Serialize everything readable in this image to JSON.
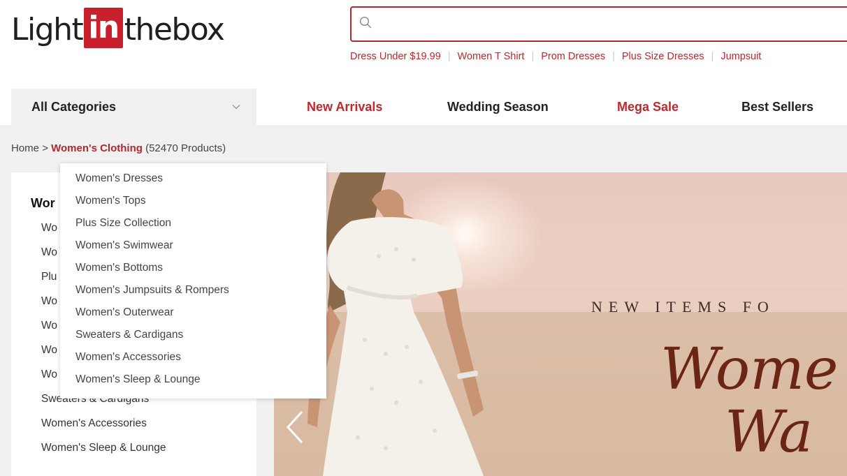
{
  "header": {
    "logo": {
      "left": "Light",
      "box": "in",
      "right": "thebox"
    },
    "search": {
      "placeholder": "",
      "value": ""
    },
    "hot_searches": [
      "Dress Under $19.99",
      "Women T Shirt",
      "Prom Dresses",
      "Plus Size Dresses",
      "Jumpsuit"
    ]
  },
  "nav": {
    "all_categories": "All Categories",
    "links": [
      {
        "label": "New Arrivals",
        "color": "#c4262d"
      },
      {
        "label": "Wedding Season",
        "color": "#222222"
      },
      {
        "label": "Mega Sale",
        "color": "#c4262d"
      },
      {
        "label": "Best Sellers",
        "color": "#222222"
      }
    ]
  },
  "breadcrumb": {
    "home": "Home",
    "separator": ">",
    "current": "Women's Clothing",
    "count": "(52470 Products)"
  },
  "sidebar": {
    "title": "Wor",
    "items": [
      "Wo",
      "Wo",
      "Plu",
      "Wo",
      "Wo",
      "Wo",
      "Wo",
      "Sweaters & Cardigans",
      "Women's Accessories",
      "Women's Sleep & Lounge"
    ]
  },
  "dropdown": {
    "items": [
      "Women's Dresses",
      "Women's Tops",
      "Plus Size Collection",
      "Women's Swimwear",
      "Women's Bottoms",
      "Women's Jumpsuits & Rompers",
      "Women's Outerwear",
      "Sweaters & Cardigans",
      "Women's Accessories",
      "Women's Sleep & Lounge"
    ]
  },
  "banner": {
    "tagline": "NEW ITEMS FO",
    "script_line1": "Wome",
    "script_line2": "Wa"
  },
  "colors": {
    "brand_red": "#c8202d",
    "link_red": "#c4262d",
    "banner_script": "#6b2515"
  }
}
